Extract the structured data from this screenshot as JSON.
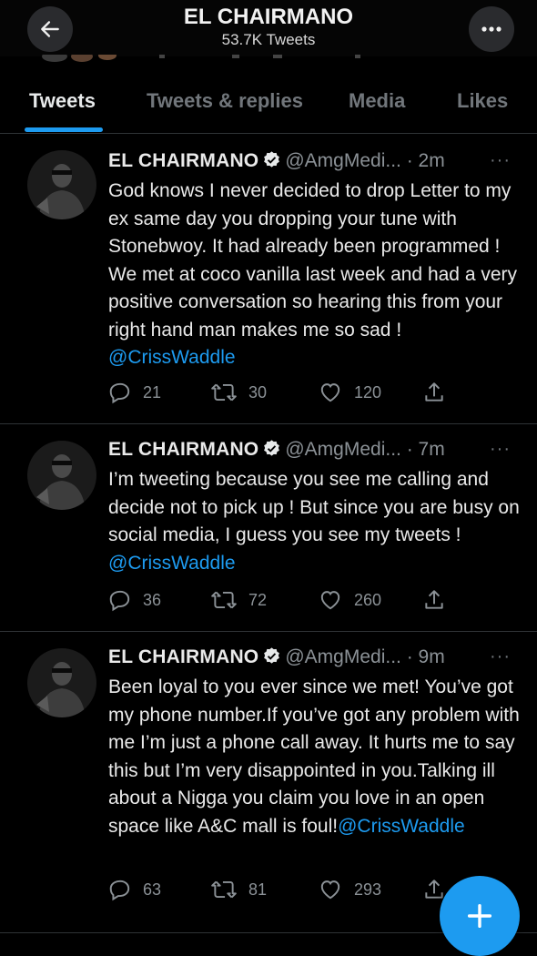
{
  "header": {
    "title": "EL CHAIRMANO",
    "subtitle": "53.7K Tweets",
    "back_icon": "arrow-left-icon",
    "more_icon": "more-horizontal-icon"
  },
  "tabs": [
    {
      "label": "Tweets",
      "active": true
    },
    {
      "label": "Tweets & replies",
      "active": false
    },
    {
      "label": "Media",
      "active": false
    },
    {
      "label": "Likes",
      "active": false
    }
  ],
  "tweets": [
    {
      "name": "EL CHAIRMANO",
      "handle": "@AmgMedi...",
      "time": "· 2m",
      "text": "God knows I never decided to drop Letter to my ex same day you dropping your tune with Stonebwoy. It had already been programmed ! We met at coco vanilla last week and had a very positive conversation so hearing this from your right hand man makes me so sad ! ",
      "mention": "@CrissWaddle",
      "replies": "21",
      "retweets": "30",
      "likes": "120"
    },
    {
      "name": "EL CHAIRMANO",
      "handle": "@AmgMedi...",
      "time": "· 7m",
      "text": "I’m tweeting because you see me calling and decide not to pick up ! But since you are busy on social media, I guess you see my tweets ! ",
      "mention": "@CrissWaddle",
      "replies": "36",
      "retweets": "72",
      "likes": "260"
    },
    {
      "name": "EL CHAIRMANO",
      "handle": "@AmgMedi...",
      "time": "· 9m",
      "text": "Been loyal to you ever since we met! You’ve got my phone number.If you’ve got any problem with me I’m just a phone call away. It hurts me to say this but I’m very disappointed in you.Talking ill about a Nigga you claim you love in an open space like A&C mall is foul!",
      "mention": "@CrissWaddle",
      "replies": "63",
      "retweets": "81",
      "likes": "293"
    }
  ],
  "more_dots": "···",
  "fab_label": "+",
  "colors": {
    "background": "#000000",
    "accent": "#1d9bf0",
    "muted": "#71767b",
    "divider": "#2f3336"
  }
}
